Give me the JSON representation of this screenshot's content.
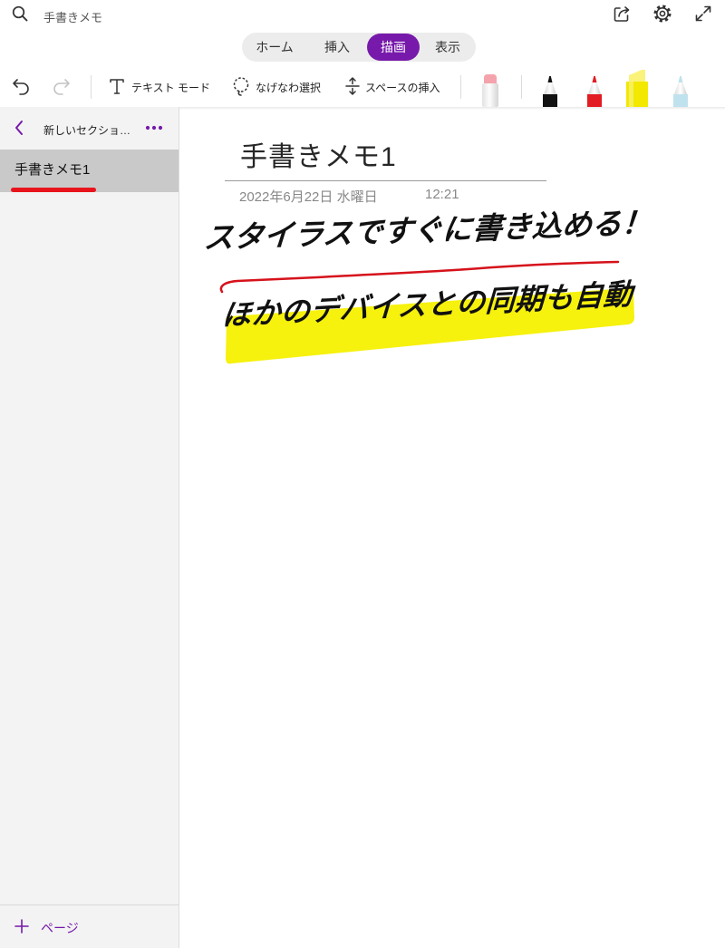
{
  "search": {
    "label": "手書きメモ"
  },
  "tabs": [
    {
      "label": "ホーム",
      "selected": false
    },
    {
      "label": "挿入",
      "selected": false
    },
    {
      "label": "描画",
      "selected": true
    },
    {
      "label": "表示",
      "selected": false
    }
  ],
  "toolbar": {
    "text_mode": "テキスト モード",
    "lasso_select": "なげなわ選択",
    "insert_space": "スペースの挿入",
    "redo_enabled": false,
    "tools": [
      {
        "icon": "eraser-icon",
        "color": "#F4A3AC"
      },
      {
        "icon": "black-pen-icon",
        "color": "#111111"
      },
      {
        "icon": "red-pen-icon",
        "color": "#E31B23"
      },
      {
        "icon": "yellow-highlighter-icon",
        "color": "#F3E800"
      },
      {
        "icon": "light-blue-pencil-icon",
        "color": "#BFE2EE"
      }
    ]
  },
  "icons": {
    "search": "search-icon",
    "share": "share-icon",
    "settings": "gear-icon",
    "fullscreen": "expand-icon",
    "undo": "undo-icon",
    "redo": "redo-icon",
    "text_mode": "text-t-icon",
    "lasso": "lasso-icon",
    "insert_space": "insert-space-icon",
    "back": "chevron-left-icon",
    "more": "more-dots-icon",
    "add_page": "plus-icon"
  },
  "colors": {
    "accent": "#7719AA",
    "ink": "#111111",
    "selected_page_bg": "#C9C9C9",
    "annotation_red": "#E8141C",
    "sidebar_bg": "#F3F3F3"
  },
  "sidebar": {
    "section_title": "新しいセクショ…",
    "pages": [
      {
        "title": "手書きメモ1",
        "selected": true
      }
    ],
    "add_page_label": "ページ"
  },
  "note": {
    "title": "手書きメモ1",
    "date": "2022年6月22日 水曜日",
    "time": "12:21",
    "ink_lines": [
      {
        "text": "スタイラスですぐに書き込める！",
        "underline_color": "#D6121B"
      },
      {
        "text": "ほかのデバイスとの同期も自動",
        "highlight_color": "#F5F000"
      }
    ]
  }
}
